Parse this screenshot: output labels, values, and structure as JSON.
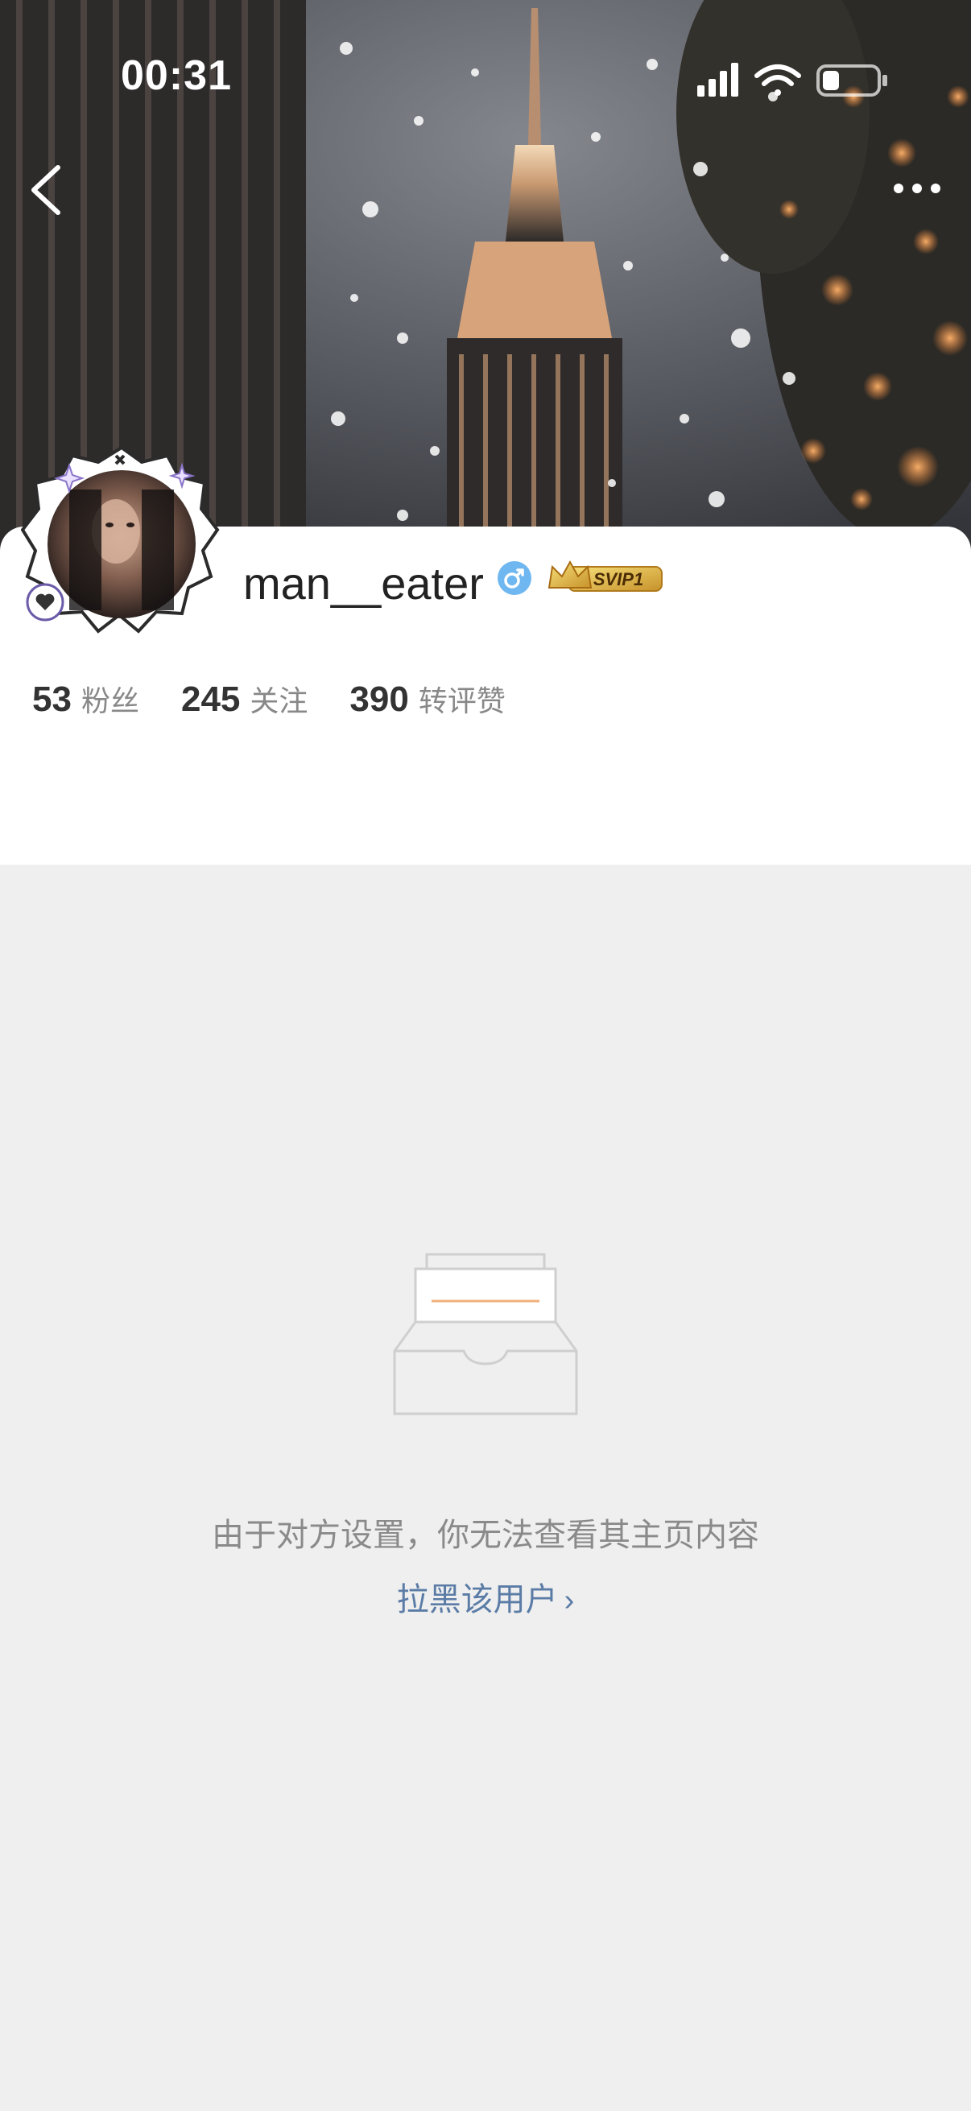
{
  "status_bar": {
    "time": "00:31"
  },
  "profile": {
    "username": "man__eater",
    "vip_label": "SVIP1",
    "stats": [
      {
        "value": "53",
        "label": "粉丝"
      },
      {
        "value": "245",
        "label": "关注"
      },
      {
        "value": "390",
        "label": "转评赞"
      }
    ]
  },
  "empty_state": {
    "message": "由于对方设置，你无法查看其主页内容",
    "block_link": "拉黑该用户"
  },
  "icons": {
    "back": "back-arrow-icon",
    "more": "more-dots-icon",
    "gender": "male-icon",
    "empty": "empty-box-icon"
  },
  "colors": {
    "link": "#5b7ca6",
    "gender_badge": "#6fb7f0",
    "page_background": "#efefef"
  }
}
